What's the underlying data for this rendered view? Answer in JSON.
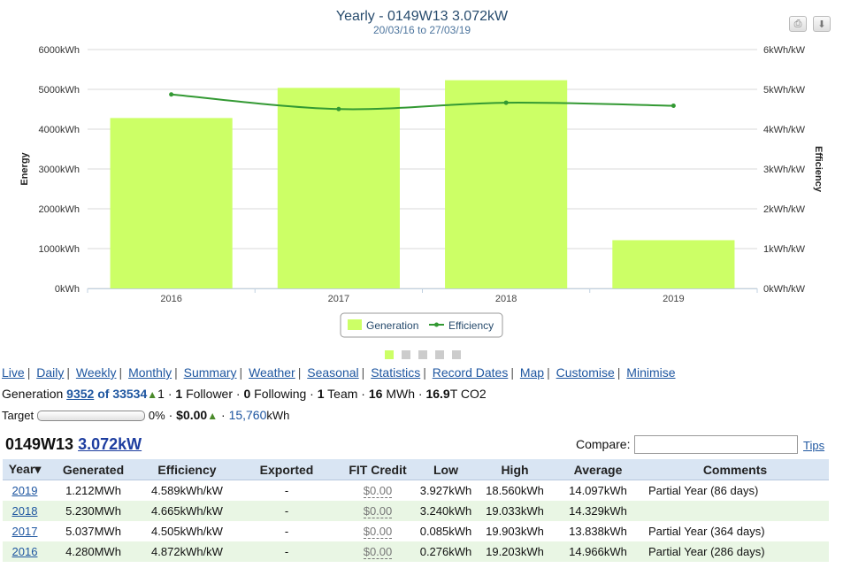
{
  "chart_data": {
    "type": "bar",
    "title": "Yearly - 0149W13 3.072kW",
    "subtitle": "20/03/16 to 27/03/19",
    "categories": [
      "2016",
      "2017",
      "2018",
      "2019"
    ],
    "series": [
      {
        "name": "Generation",
        "type": "bar",
        "axis": "left",
        "values": [
          4280,
          5037,
          5230,
          1212
        ],
        "color": "#ccff66"
      },
      {
        "name": "Efficiency",
        "type": "line",
        "axis": "right",
        "values": [
          4.872,
          4.505,
          4.665,
          4.589
        ],
        "color": "#339933"
      }
    ],
    "ylabel": "Energy",
    "ylabel_right": "Efficiency",
    "ylim": [
      0,
      6000
    ],
    "ylim_right": [
      0,
      6
    ],
    "yticks": [
      "0kWh",
      "1000kWh",
      "2000kWh",
      "3000kWh",
      "4000kWh",
      "5000kWh",
      "6000kWh"
    ],
    "yticks_right": [
      "0kWh/kW",
      "1kWh/kW",
      "2kWh/kW",
      "3kWh/kW",
      "4kWh/kW",
      "5kWh/kW",
      "6kWh/kW"
    ],
    "grid": true,
    "legend": "bottom-center"
  },
  "toolbar": {
    "print_icon": "printer-icon",
    "download_icon": "download-icon"
  },
  "page_dots": {
    "count": 5,
    "active": 0,
    "active_color": "#ccff66",
    "inactive_color": "#cccccc"
  },
  "nav": [
    "Live",
    "Daily",
    "Weekly",
    "Monthly",
    "Summary",
    "Weather",
    "Seasonal",
    "Statistics",
    "Record Dates",
    "Map",
    "Customise",
    "Minimise"
  ],
  "generation_line": {
    "label": "Generation",
    "rank": "9352",
    "of_text": "of 33534",
    "rank_change": "1",
    "followers_count": "1",
    "followers_label": "Follower",
    "following_count": "0",
    "following_label": "Following",
    "team_count": "1",
    "team_label": "Team",
    "mwh_value": "16",
    "mwh_label": "MWh",
    "co2_value": "16.9",
    "co2_label": "T CO2"
  },
  "target_line": {
    "label": "Target",
    "progress": 0,
    "percent_text": "0%",
    "amount": "$0.00",
    "kwh_value": "15,760",
    "kwh_unit": "kWh"
  },
  "system": {
    "name": "0149W13",
    "capacity": "3.072kW"
  },
  "compare": {
    "label": "Compare:",
    "value": ""
  },
  "tips_label": "Tips",
  "table": {
    "headers": [
      "Year▾",
      "Generated",
      "Efficiency",
      "Exported",
      "FIT Credit",
      "Low",
      "High",
      "Average",
      "Comments"
    ],
    "rows": [
      {
        "year": "2019",
        "generated": "1.212MWh",
        "efficiency": "4.589kWh/kW",
        "exported": "-",
        "fit": "$0.00",
        "low": "3.927kWh",
        "high": "18.560kWh",
        "average": "14.097kWh",
        "comments": "Partial Year (86 days)"
      },
      {
        "year": "2018",
        "generated": "5.230MWh",
        "efficiency": "4.665kWh/kW",
        "exported": "-",
        "fit": "$0.00",
        "low": "3.240kWh",
        "high": "19.033kWh",
        "average": "14.329kWh",
        "comments": ""
      },
      {
        "year": "2017",
        "generated": "5.037MWh",
        "efficiency": "4.505kWh/kW",
        "exported": "-",
        "fit": "$0.00",
        "low": "0.085kWh",
        "high": "19.903kWh",
        "average": "13.838kWh",
        "comments": "Partial Year (364 days)"
      },
      {
        "year": "2016",
        "generated": "4.280MWh",
        "efficiency": "4.872kWh/kW",
        "exported": "-",
        "fit": "$0.00",
        "low": "0.276kWh",
        "high": "19.203kWh",
        "average": "14.966kWh",
        "comments": "Partial Year (286 days)"
      }
    ]
  }
}
